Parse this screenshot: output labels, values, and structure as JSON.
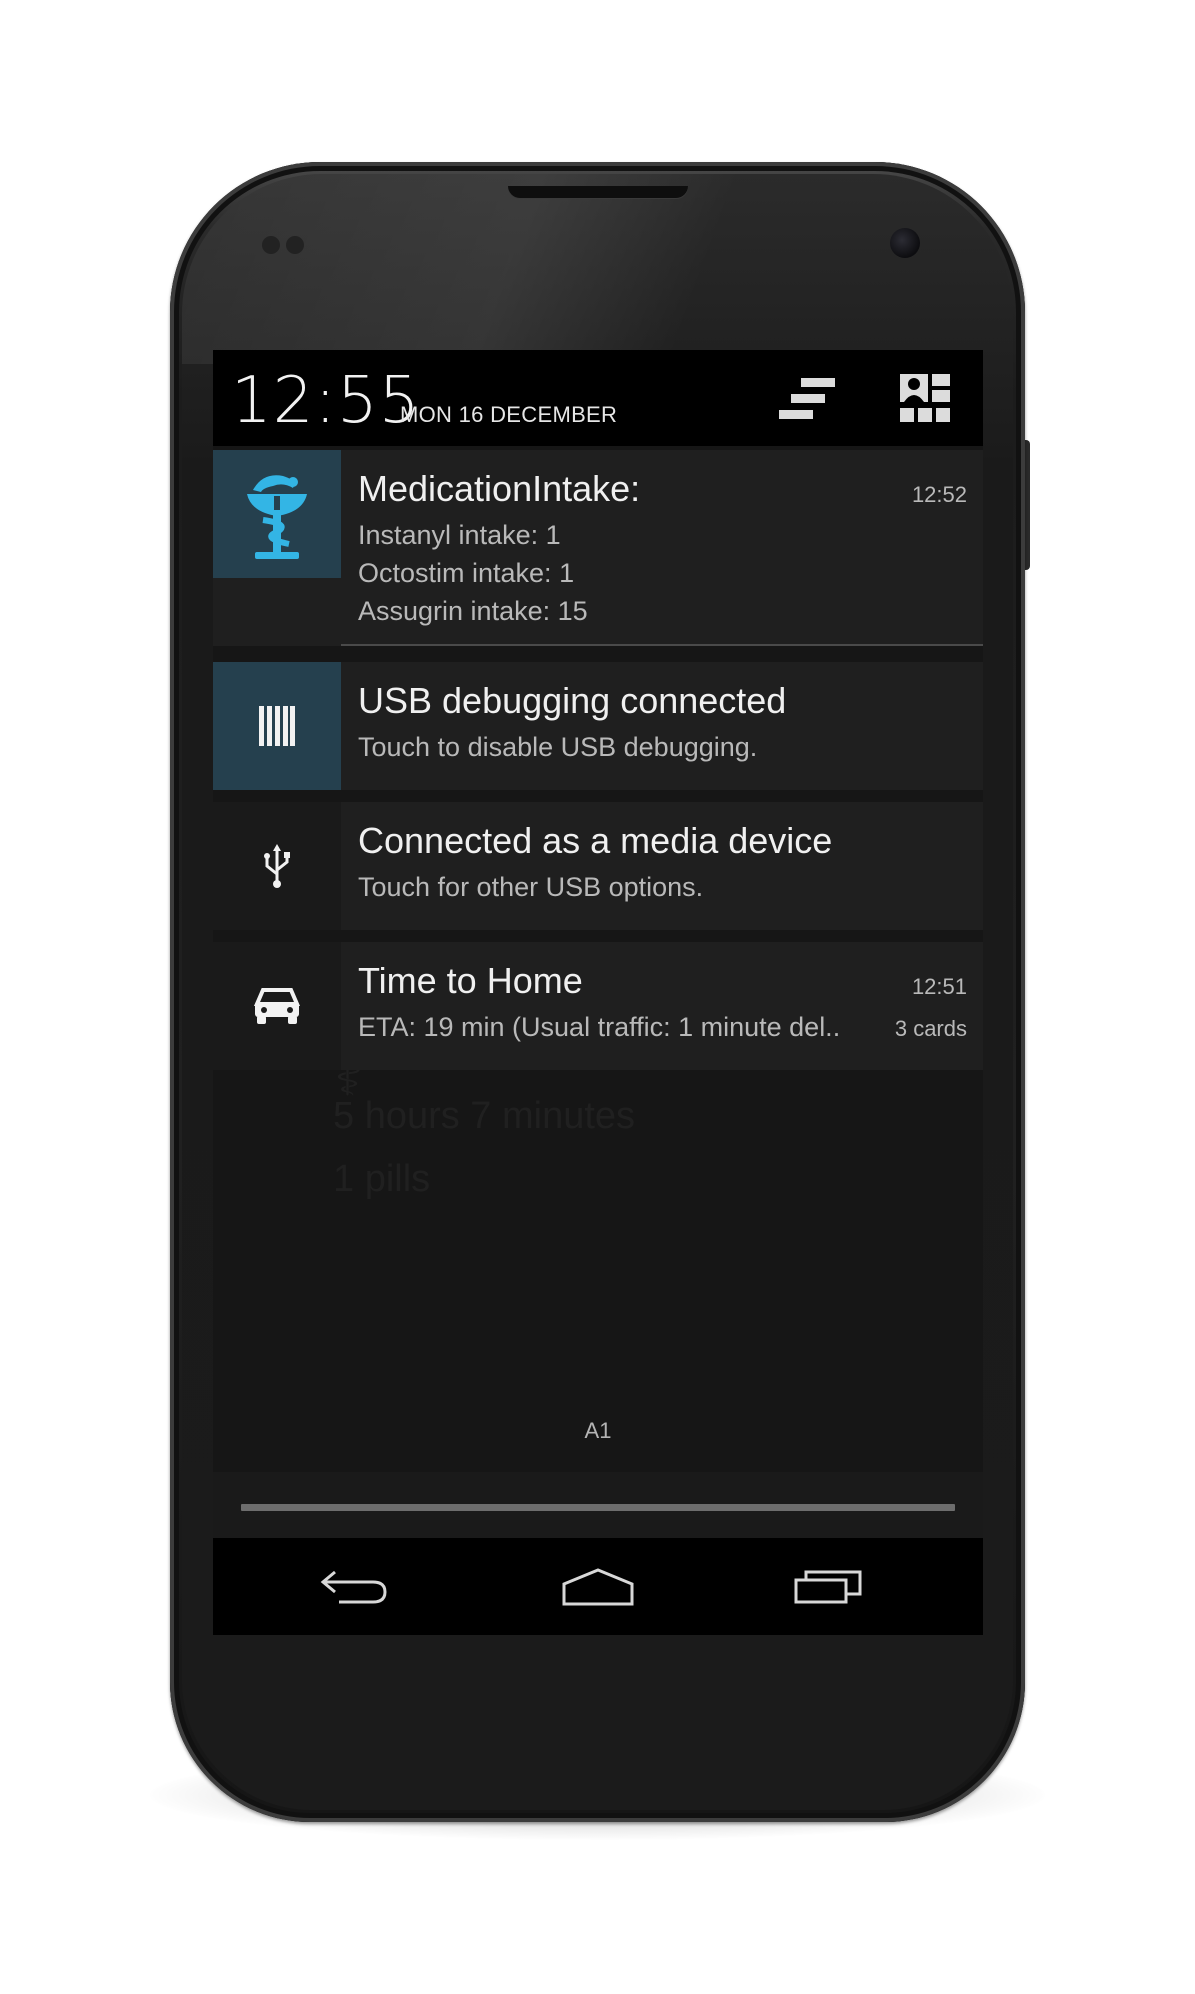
{
  "status_header": {
    "time": "12:55",
    "date": "MON 16 DECEMBER",
    "buttons": [
      {
        "icon": "clear-all-icon"
      },
      {
        "icon": "quick-settings-icon"
      }
    ]
  },
  "notifications": [
    {
      "icon": "pharmacy-caduceus-icon",
      "icon_color": "#33b5e5",
      "title": "MedicationIntake:",
      "time": "12:52",
      "lines": [
        "Instanyl intake: 1",
        "Octostim intake: 1",
        "Assugrin intake: 15"
      ]
    },
    {
      "icon": "usb-debugging-icon",
      "title": "USB debugging connected",
      "lines": [
        "Touch to disable USB debugging."
      ]
    },
    {
      "icon": "usb-icon",
      "title": "Connected as a media device",
      "lines": [
        "Touch for other USB options."
      ]
    },
    {
      "icon": "car-icon",
      "title": "Time to Home",
      "time": "12:51",
      "lines": [
        "ETA: 19 min (Usual traffic: 1 minute del.."
      ],
      "extra": "3 cards"
    }
  ],
  "background_ghost": {
    "line1": "5 hours 7 minutes",
    "line2": "1 pills"
  },
  "carrier": "A1",
  "nav": [
    {
      "icon": "back-icon"
    },
    {
      "icon": "home-icon"
    },
    {
      "icon": "recent-apps-icon"
    }
  ],
  "colors": {
    "accent": "#33b5e5",
    "icon_tile": "#25404e",
    "notification_bg": "#1f1f1f",
    "header_bg": "#000000"
  }
}
